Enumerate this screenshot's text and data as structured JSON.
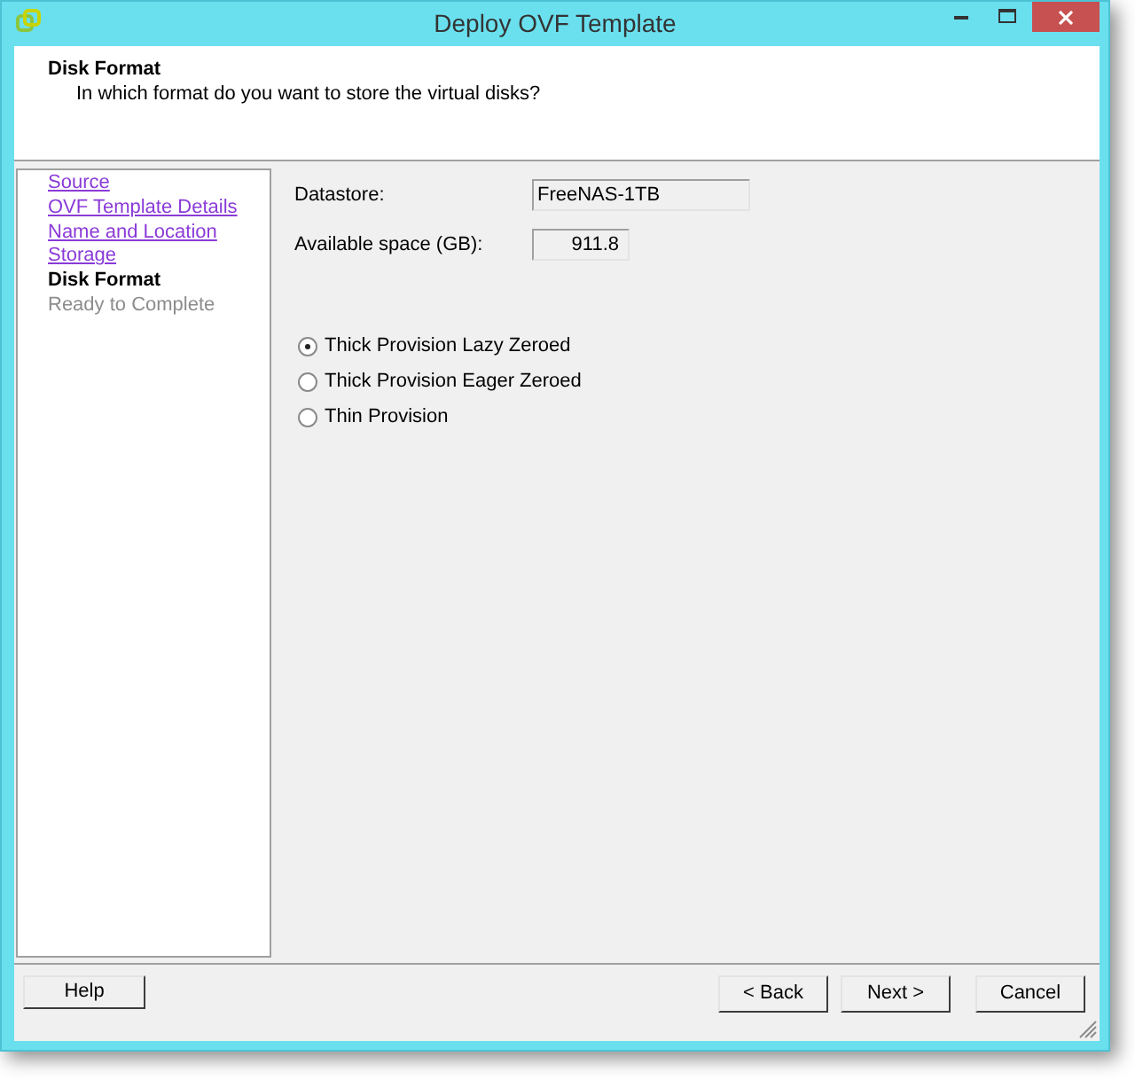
{
  "window": {
    "title": "Deploy OVF Template"
  },
  "header": {
    "title": "Disk Format",
    "subtitle": "In which format do you want to store the virtual disks?"
  },
  "steps": [
    {
      "label": "Source",
      "kind": "link"
    },
    {
      "label": "OVF Template Details",
      "kind": "link"
    },
    {
      "label": "Name and Location",
      "kind": "link"
    },
    {
      "label": "Storage",
      "kind": "link"
    },
    {
      "label": "Disk Format",
      "kind": "current"
    },
    {
      "label": "Ready to Complete",
      "kind": "pending"
    }
  ],
  "fields": [
    {
      "label": "Datastore:",
      "value": "FreeNAS-1TB",
      "kind": "text"
    },
    {
      "label": "Available space (GB):",
      "value": "911.8",
      "kind": "number"
    }
  ],
  "disk_formats": [
    {
      "label": "Thick Provision Lazy Zeroed",
      "selected": true
    },
    {
      "label": "Thick Provision Eager Zeroed",
      "selected": false
    },
    {
      "label": "Thin Provision",
      "selected": false
    }
  ],
  "footer": {
    "help": "Help",
    "navigation": [
      "< Back",
      "Next >"
    ],
    "cancel": "Cancel"
  }
}
